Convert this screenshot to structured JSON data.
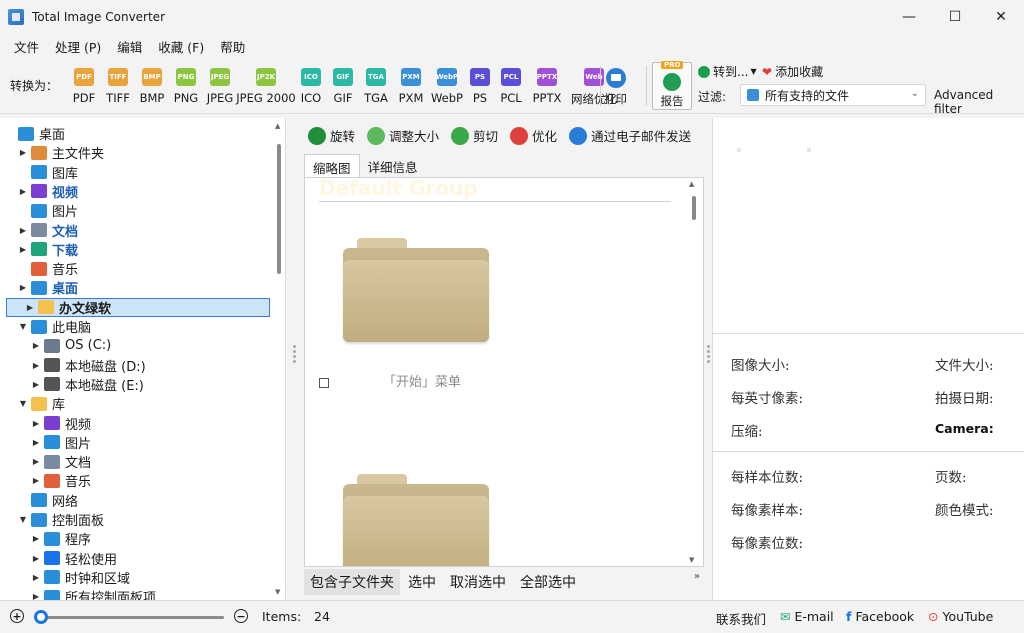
{
  "window": {
    "title": "Total Image Converter"
  },
  "menu": [
    "文件",
    "处理 (P)",
    "编辑",
    "收藏 (F)",
    "帮助"
  ],
  "toolbar": {
    "convert_label": "转换为：",
    "formats": [
      {
        "badge": "PDF",
        "label": "PDF",
        "color": "#e8a33a"
      },
      {
        "badge": "TIFF",
        "label": "TIFF",
        "color": "#e8a33a"
      },
      {
        "badge": "BMP",
        "label": "BMP",
        "color": "#e8a33a"
      },
      {
        "badge": "PNG",
        "label": "PNG",
        "color": "#8cc63f"
      },
      {
        "badge": "JPEG",
        "label": "JPEG",
        "color": "#8cc63f"
      },
      {
        "badge": "JP2K",
        "label": "JPEG 2000",
        "color": "#8cc63f"
      },
      {
        "badge": "ICO",
        "label": "ICO",
        "color": "#2bb8a4"
      },
      {
        "badge": "GIF",
        "label": "GIF",
        "color": "#2bb8a4"
      },
      {
        "badge": "TGA",
        "label": "TGA",
        "color": "#2bb8a4"
      },
      {
        "badge": "PXM",
        "label": "PXM",
        "color": "#3a8fd9"
      },
      {
        "badge": "WebP",
        "label": "WebP",
        "color": "#3a8fd9"
      },
      {
        "badge": "PS",
        "label": "PS",
        "color": "#5b4fd9"
      },
      {
        "badge": "PCL",
        "label": "PCL",
        "color": "#5b4fd9"
      },
      {
        "badge": "PPTX",
        "label": "PPTX",
        "color": "#a04fd9"
      },
      {
        "badge": "Web",
        "label": "网络优化",
        "color": "#a04fd9"
      }
    ],
    "print_label": "打印",
    "report_label": "报告",
    "pro_badge": "PRO",
    "goto_label": "转到...",
    "favorite_label": "添加收藏",
    "filter_label": "过滤:",
    "filter_value": "所有支持的文件",
    "advanced_filter": "Advanced filter"
  },
  "tree": [
    {
      "label": "桌面",
      "indent": 0,
      "arrow": "",
      "style": "",
      "icon": "desktop-icon",
      "color": "#2a8fd8"
    },
    {
      "label": "主文件夹",
      "indent": 1,
      "arrow": "▶",
      "style": "",
      "icon": "home-icon",
      "color": "#e08a3c"
    },
    {
      "label": "图库",
      "indent": 1,
      "arrow": "",
      "style": "",
      "icon": "gallery-icon",
      "color": "#2a8fd8"
    },
    {
      "label": "视频",
      "indent": 1,
      "arrow": "▶",
      "style": "blue",
      "icon": "video-icon",
      "color": "#7a3fd1"
    },
    {
      "label": "图片",
      "indent": 1,
      "arrow": "",
      "style": "",
      "icon": "pictures-icon",
      "color": "#2a8fd8"
    },
    {
      "label": "文档",
      "indent": 1,
      "arrow": "▶",
      "style": "blue",
      "icon": "documents-icon",
      "color": "#7a8aa0"
    },
    {
      "label": "下载",
      "indent": 1,
      "arrow": "▶",
      "style": "blue",
      "icon": "download-icon",
      "color": "#1fa37a"
    },
    {
      "label": "音乐",
      "indent": 1,
      "arrow": "",
      "style": "",
      "icon": "music-icon",
      "color": "#e0603c"
    },
    {
      "label": "桌面",
      "indent": 1,
      "arrow": "▶",
      "style": "blue",
      "icon": "desktop-icon",
      "color": "#2a8fd8"
    },
    {
      "label": "办文绿软",
      "indent": 1,
      "arrow": "▶",
      "style": "bold selected",
      "icon": "folder-icon",
      "color": "#f2c14e"
    },
    {
      "label": "此电脑",
      "indent": 1,
      "arrow": "▼",
      "style": "",
      "icon": "computer-icon",
      "color": "#2a8fd8"
    },
    {
      "label": "OS (C:)",
      "indent": 2,
      "arrow": "▶",
      "style": "",
      "icon": "drive-c-icon",
      "color": "#6b7b8c"
    },
    {
      "label": "本地磁盘 (D:)",
      "indent": 2,
      "arrow": "▶",
      "style": "",
      "icon": "drive-icon",
      "color": "#555555"
    },
    {
      "label": "本地磁盘 (E:)",
      "indent": 2,
      "arrow": "▶",
      "style": "",
      "icon": "drive-icon",
      "color": "#555555"
    },
    {
      "label": "库",
      "indent": 1,
      "arrow": "▼",
      "style": "",
      "icon": "library-icon",
      "color": "#f2c14e"
    },
    {
      "label": "视频",
      "indent": 2,
      "arrow": "▶",
      "style": "",
      "icon": "video-icon",
      "color": "#7a3fd1"
    },
    {
      "label": "图片",
      "indent": 2,
      "arrow": "▶",
      "style": "",
      "icon": "pictures-icon",
      "color": "#2a8fd8"
    },
    {
      "label": "文档",
      "indent": 2,
      "arrow": "▶",
      "style": "",
      "icon": "documents-icon",
      "color": "#7a8aa0"
    },
    {
      "label": "音乐",
      "indent": 2,
      "arrow": "▶",
      "style": "",
      "icon": "music-icon",
      "color": "#e0603c"
    },
    {
      "label": "网络",
      "indent": 1,
      "arrow": "",
      "style": "",
      "icon": "network-icon",
      "color": "#2a8fd8"
    },
    {
      "label": "控制面板",
      "indent": 1,
      "arrow": "▼",
      "style": "",
      "icon": "control-panel-icon",
      "color": "#2a8fd8"
    },
    {
      "label": "程序",
      "indent": 2,
      "arrow": "▶",
      "style": "",
      "icon": "programs-icon",
      "color": "#2a8fd8"
    },
    {
      "label": "轻松使用",
      "indent": 2,
      "arrow": "▶",
      "style": "",
      "icon": "accessibility-icon",
      "color": "#1a73e8"
    },
    {
      "label": "时钟和区域",
      "indent": 2,
      "arrow": "▶",
      "style": "",
      "icon": "clock-icon",
      "color": "#2a8fd8"
    },
    {
      "label": "所有控制面板项",
      "indent": 2,
      "arrow": "▶",
      "style": "",
      "icon": "control-items-icon",
      "color": "#2a8fd8"
    }
  ],
  "actions": [
    {
      "label": "旋转",
      "color": "#1f8f3a",
      "icon": "rotate-icon"
    },
    {
      "label": "调整大小",
      "color": "#5cb85c",
      "icon": "resize-icon"
    },
    {
      "label": "剪切",
      "color": "#3aa84a",
      "icon": "crop-icon"
    },
    {
      "label": "优化",
      "color": "#e0403c",
      "icon": "optimize-icon"
    },
    {
      "label": "通过电子邮件发送",
      "color": "#2a7bd5",
      "icon": "email-icon"
    }
  ],
  "tabs": [
    "缩略图",
    "详细信息"
  ],
  "group_header": "Default Group",
  "folder_label": "「开始」菜单",
  "bottom_actions": [
    "包含子文件夹",
    "选中",
    "取消选中",
    "全部选中"
  ],
  "info": {
    "image_size": "图像大小:",
    "file_size": "文件大小:",
    "ppi": "每英寸像素:",
    "date_taken": "拍摄日期:",
    "compression": "压缩:",
    "camera": "Camera:",
    "bits_per_sample": "每样本位数:",
    "pages": "页数:",
    "samples_per_pixel": "每像素样本:",
    "color_mode": "颜色模式:",
    "bits_per_pixel": "每像素位数:"
  },
  "status": {
    "items_label": "Items:",
    "items_count": "24",
    "contact": "联系我们",
    "email": "E-mail",
    "facebook": "Facebook",
    "youtube": "YouTube"
  }
}
